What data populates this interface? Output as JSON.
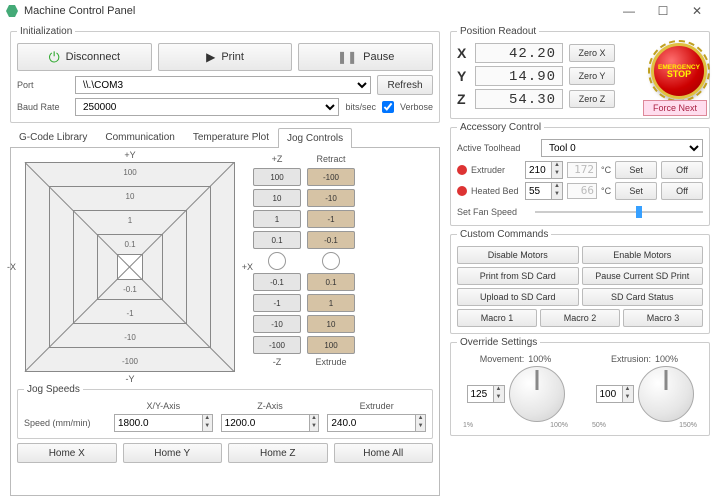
{
  "window": {
    "title": "Machine Control Panel"
  },
  "init": {
    "legend": "Initialization",
    "disconnect": "Disconnect",
    "print": "Print",
    "pause": "Pause",
    "port_label": "Port",
    "port_value": "\\\\.\\COM3",
    "refresh": "Refresh",
    "baud_label": "Baud Rate",
    "baud_value": "250000",
    "baud_units": "bits/sec",
    "verbose_label": "Verbose"
  },
  "tabs": {
    "gcode": "G-Code Library",
    "comm": "Communication",
    "temp": "Temperature Plot",
    "jog": "Jog Controls"
  },
  "jog": {
    "plusY": "+Y",
    "minusY": "-Y",
    "plusX": "+X",
    "minusX": "-X",
    "plusZ": "+Z",
    "minusZ": "-Z",
    "retract": "Retract",
    "extrude": "Extrude",
    "steps_100": "100",
    "steps_10": "10",
    "steps_1": "1",
    "steps_01": "0.1",
    "neg_100": "-100",
    "neg_10": "-10",
    "neg_1": "-1",
    "neg_01": "-0.1",
    "r_100": "-100",
    "r_10": "-10",
    "r_1": "-1",
    "r_01": "-0.1",
    "e_100": "100",
    "e_10": "10",
    "e_1": "1",
    "e_01": "0.1",
    "speeds_legend": "Jog Speeds",
    "xy_label": "X/Y-Axis",
    "z_label": "Z-Axis",
    "e_label": "Extruder",
    "speed_label": "Speed (mm/min)",
    "xy_speed": "1800.0",
    "z_speed": "1200.0",
    "e_speed": "240.0",
    "home_x": "Home X",
    "home_y": "Home Y",
    "home_z": "Home Z",
    "home_all": "Home All"
  },
  "position": {
    "legend": "Position Readout",
    "x_label": "X",
    "y_label": "Y",
    "z_label": "Z",
    "x": "42.20",
    "y": "14.90",
    "z": "54.30",
    "zero_x": "Zero X",
    "zero_y": "Zero Y",
    "zero_z": "Zero Z",
    "force_next": "Force Next",
    "estop_top": "EMERGENCY",
    "estop_bot": "STOP"
  },
  "accessory": {
    "legend": "Accessory Control",
    "toolhead_label": "Active Toolhead",
    "toolhead_value": "Tool 0",
    "extruder_label": "Extruder",
    "extruder_set": "210",
    "extruder_read": "172",
    "bed_label": "Heated Bed",
    "bed_set": "55",
    "bed_read": "66",
    "deg": "°C",
    "set": "Set",
    "off": "Off",
    "fan_label": "Set Fan Speed"
  },
  "custom": {
    "legend": "Custom Commands",
    "disable": "Disable Motors",
    "enable": "Enable Motors",
    "print_sd": "Print from SD Card",
    "pause_sd": "Pause Current SD Print",
    "upload_sd": "Upload to SD Card",
    "status_sd": "SD Card Status",
    "m1": "Macro 1",
    "m2": "Macro 2",
    "m3": "Macro 3"
  },
  "override": {
    "legend": "Override Settings",
    "movement_label": "Movement:",
    "movement_val": "125",
    "movement_pct": "100%",
    "extrusion_label": "Extrusion:",
    "extrusion_val": "100",
    "extrusion_pct": "100%",
    "t1": "1%",
    "t50": "50%",
    "t100": "100%",
    "t150": "150%"
  }
}
